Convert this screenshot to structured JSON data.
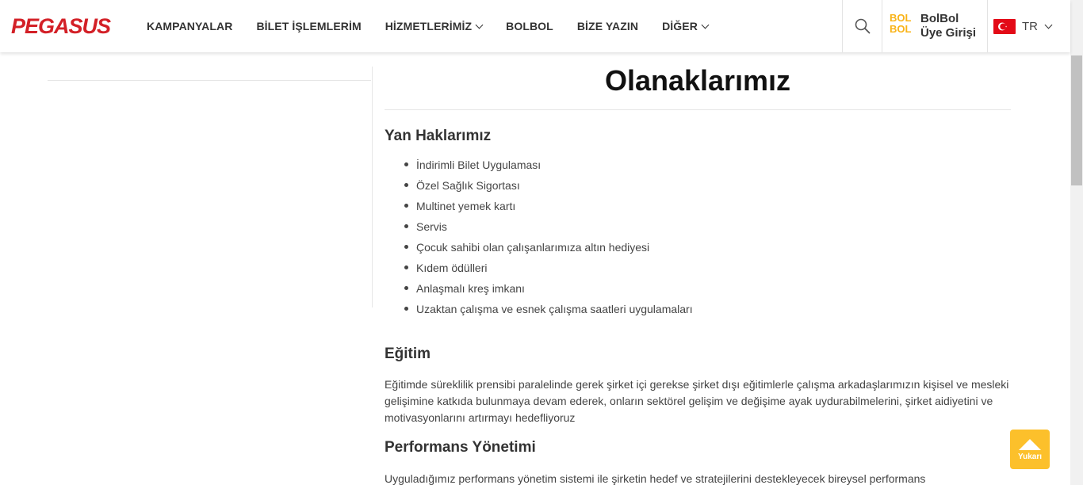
{
  "header": {
    "logo_text": "PEGASUS",
    "nav": [
      {
        "label": "KAMPANYALAR",
        "has_dropdown": false
      },
      {
        "label": "BİLET İŞLEMLERİM",
        "has_dropdown": false
      },
      {
        "label": "HİZMETLERİMİZ",
        "has_dropdown": true
      },
      {
        "label": "BOLBOL",
        "has_dropdown": false
      },
      {
        "label": "BİZE YAZIN",
        "has_dropdown": false
      },
      {
        "label": "DİĞER",
        "has_dropdown": true
      }
    ],
    "search_icon": "search-icon",
    "bolbol": {
      "logo_top": "BOL",
      "logo_bottom": "BOL",
      "line1": "BolBol",
      "line2": "Üye Girişi"
    },
    "language": {
      "code": "TR",
      "flag": "turkey-flag-icon"
    }
  },
  "colors": {
    "brand_red": "#d32027",
    "bolbol_yellow": "#f9b317",
    "to_top_yellow": "#fcc02b"
  },
  "main": {
    "title": "Olanaklarımız",
    "perks": {
      "heading": "Yan Haklarımız",
      "items": [
        "İndirimli Bilet Uygulaması",
        "Özel Sağlık Sigortası",
        "Multinet yemek kartı",
        "Servis",
        "Çocuk sahibi olan çalışanlarımıza altın hediyesi",
        "Kıdem ödülleri",
        "Anlaşmalı kreş imkanı",
        "Uzaktan çalışma ve esnek çalışma saatleri uygulamaları"
      ]
    },
    "education": {
      "heading": "Eğitim",
      "text": "Eğitimde süreklilik prensibi paralelinde gerek şirket içi gerekse şirket dışı eğitimlerle çalışma arkadaşlarımızın kişisel ve mesleki gelişimine katkıda bulunmaya devam ederek, onların sektörel gelişim ve değişime ayak uydurabilmelerini, şirket aidiyetini ve motivasyonlarını artırmayı hedefliyoruz"
    },
    "performance": {
      "heading": "Performans Yönetimi",
      "text": "Uyguladığımız performans yönetim sistemi ile şirketin hedef ve stratejilerini destekleyecek bireysel performans"
    }
  },
  "to_top": {
    "label": "Yukarı"
  }
}
